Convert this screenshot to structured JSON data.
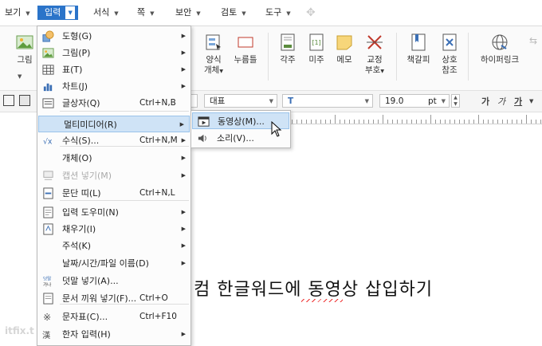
{
  "menubar": {
    "items": [
      {
        "label": "보기"
      },
      {
        "label": "입력",
        "active": true
      },
      {
        "label": "서식"
      },
      {
        "label": "쪽"
      },
      {
        "label": "보안"
      },
      {
        "label": "검토"
      },
      {
        "label": "도구"
      }
    ]
  },
  "ribbon": {
    "left_label": "그림",
    "buttons": [
      {
        "label": "양식",
        "label2": "개체"
      },
      {
        "label": "누름틀"
      },
      {
        "label": "각주"
      },
      {
        "label": "미주"
      },
      {
        "label": "메모"
      },
      {
        "label": "교정",
        "label2": "부호"
      },
      {
        "label": "책갈피"
      },
      {
        "label": "상호",
        "label2": "참조"
      },
      {
        "label": "하이퍼링크"
      }
    ]
  },
  "format_bar": {
    "style_value": "대표",
    "font_value": "",
    "font_icon": "T",
    "size_value": "19.0",
    "size_unit": "pt",
    "bold": "가",
    "italic": "가",
    "underline": "가"
  },
  "menu": {
    "items": [
      {
        "icon": "shape-icon",
        "label": "도형(G)",
        "shortcut": "",
        "submenu": true
      },
      {
        "icon": "picture-icon",
        "label": "그림(P)",
        "shortcut": "",
        "submenu": true
      },
      {
        "icon": "table-icon",
        "label": "표(T)",
        "shortcut": "",
        "submenu": true
      },
      {
        "icon": "chart-icon",
        "label": "차트(J)",
        "shortcut": "",
        "submenu": true
      },
      {
        "icon": "textbox-icon",
        "label": "글상자(Q)",
        "shortcut": "Ctrl+N,B",
        "submenu": false
      },
      {
        "icon": "",
        "label": "멀티미디어(R)",
        "shortcut": "",
        "submenu": true,
        "highlighted": true
      },
      {
        "icon": "formula-icon",
        "label": "수식(S)...",
        "shortcut": "Ctrl+N,M",
        "submenu": true
      },
      {
        "icon": "",
        "label": "개체(O)",
        "shortcut": "",
        "submenu": true
      },
      {
        "icon": "caption-icon",
        "label": "캡션 넣기(M)",
        "shortcut": "",
        "submenu": true,
        "disabled": true
      },
      {
        "icon": "paragraph-strip-icon",
        "label": "문단 띠(L)",
        "shortcut": "Ctrl+N,L",
        "submenu": false
      },
      {
        "icon": "input-helper-icon",
        "label": "입력 도우미(N)",
        "shortcut": "",
        "submenu": true
      },
      {
        "icon": "fill-icon",
        "label": "채우기(I)",
        "shortcut": "",
        "submenu": true
      },
      {
        "icon": "",
        "label": "주석(K)",
        "shortcut": "",
        "submenu": true
      },
      {
        "icon": "",
        "label": "날짜/시간/파일 이름(D)",
        "shortcut": "",
        "submenu": true
      },
      {
        "icon": "overlay-text-icon",
        "label": "덧말 넣기(A)...",
        "shortcut": "",
        "submenu": false
      },
      {
        "icon": "insert-document-icon",
        "label": "문서 끼워 넣기(F)...",
        "shortcut": "Ctrl+O",
        "submenu": false
      },
      {
        "icon": "symbol-icon",
        "label": "문자표(C)...",
        "shortcut": "Ctrl+F10",
        "submenu": false
      },
      {
        "icon": "hanja-icon",
        "label": "한자 입력(H)",
        "shortcut": "",
        "submenu": true
      }
    ]
  },
  "submenu": {
    "items": [
      {
        "icon": "video-icon",
        "label": "동영상(M)...",
        "highlighted": true
      },
      {
        "icon": "speaker-icon",
        "label": "소리(V)..."
      }
    ]
  },
  "document": {
    "text": "컴 한글워드에 동영상 삽입하기"
  },
  "watermark": "itfix.t",
  "colors": {
    "accent": "#2b74c9",
    "highlight": "#cfe3f6",
    "highlight_border": "#9ac3ea"
  }
}
